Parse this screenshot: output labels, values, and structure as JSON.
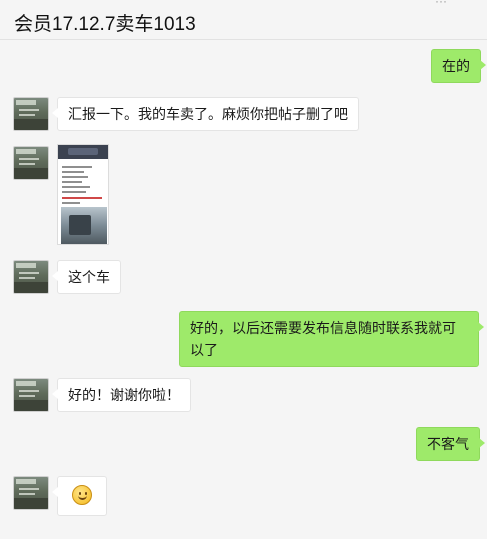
{
  "header": {
    "title": "会员17.12.7卖车1013",
    "more_icon": "more-icon"
  },
  "messages": [
    {
      "side": "out",
      "text": "在的"
    },
    {
      "side": "in",
      "text": "汇报一下。我的车卖了。麻烦你把帖子删了吧"
    },
    {
      "side": "in",
      "type": "image",
      "image_icon": "screenshot-thumbnail"
    },
    {
      "side": "in",
      "text": "这个车"
    },
    {
      "side": "out",
      "text": "好的，以后还需要发布信息随时联系我就可以了"
    },
    {
      "side": "in",
      "text": "好的！谢谢你啦！"
    },
    {
      "side": "out",
      "text": "不客气"
    },
    {
      "side": "in",
      "type": "emoji",
      "emoji_icon": "smile-emoji-icon"
    }
  ],
  "colors": {
    "background": "#f5f5f5",
    "outgoing_bubble": "#9eea6a",
    "incoming_bubble": "#ffffff"
  }
}
